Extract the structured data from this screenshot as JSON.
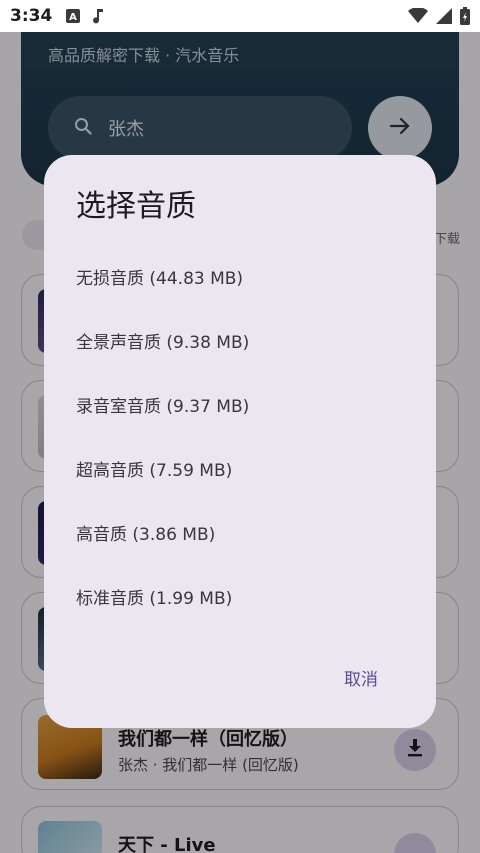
{
  "status_bar": {
    "time": "3:34"
  },
  "header": {
    "subtitle": "高品质解密下载 · 汽水音乐"
  },
  "search": {
    "query": "张杰"
  },
  "list": {
    "right_label": "下载",
    "items": [
      {
        "title": "我们都一样（回忆版）",
        "subtitle": "张杰 · 我们都一样 (回忆版)"
      },
      {
        "title": "天下 - Live",
        "subtitle": ""
      }
    ]
  },
  "dialog": {
    "title": "选择音质",
    "options": [
      "无损音质 (44.83 MB)",
      "全景声音质 (9.38 MB)",
      "录音室音质 (9.37 MB)",
      "超高音质 (7.59 MB)",
      "高音质 (3.86 MB)",
      "标准音质 (1.99 MB)"
    ],
    "cancel": "取消"
  },
  "colors": {
    "accent": "#5a4a9a",
    "dialog_bg": "#ece6f0",
    "header_bg": "#1f3a4d"
  },
  "icons": [
    "a-app-icon",
    "music-note-icon",
    "wifi-icon",
    "signal-icon",
    "battery-icon",
    "search-icon",
    "arrow-right-icon",
    "download-icon"
  ]
}
